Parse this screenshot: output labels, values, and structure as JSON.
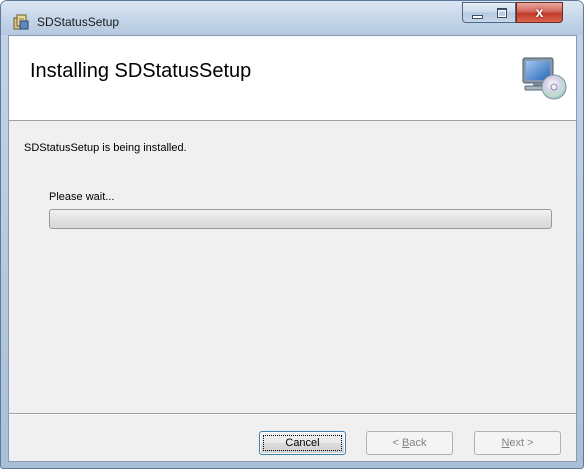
{
  "window": {
    "title": "SDStatusSetup",
    "close_glyph": "x"
  },
  "banner": {
    "title": "Installing SDStatusSetup",
    "icon": "computer-cd-icon"
  },
  "status": {
    "message": "SDStatusSetup is being installed.",
    "wait_label": "Please wait...",
    "progress_fraction": 0.0
  },
  "buttons": {
    "cancel": "Cancel",
    "back_prefix": "< ",
    "back_accel": "B",
    "back_rest": "ack",
    "next_accel": "N",
    "next_rest": "ext >"
  },
  "colors": {
    "title_accent": "#c23a2c",
    "progress_fill": "#56d54a"
  }
}
